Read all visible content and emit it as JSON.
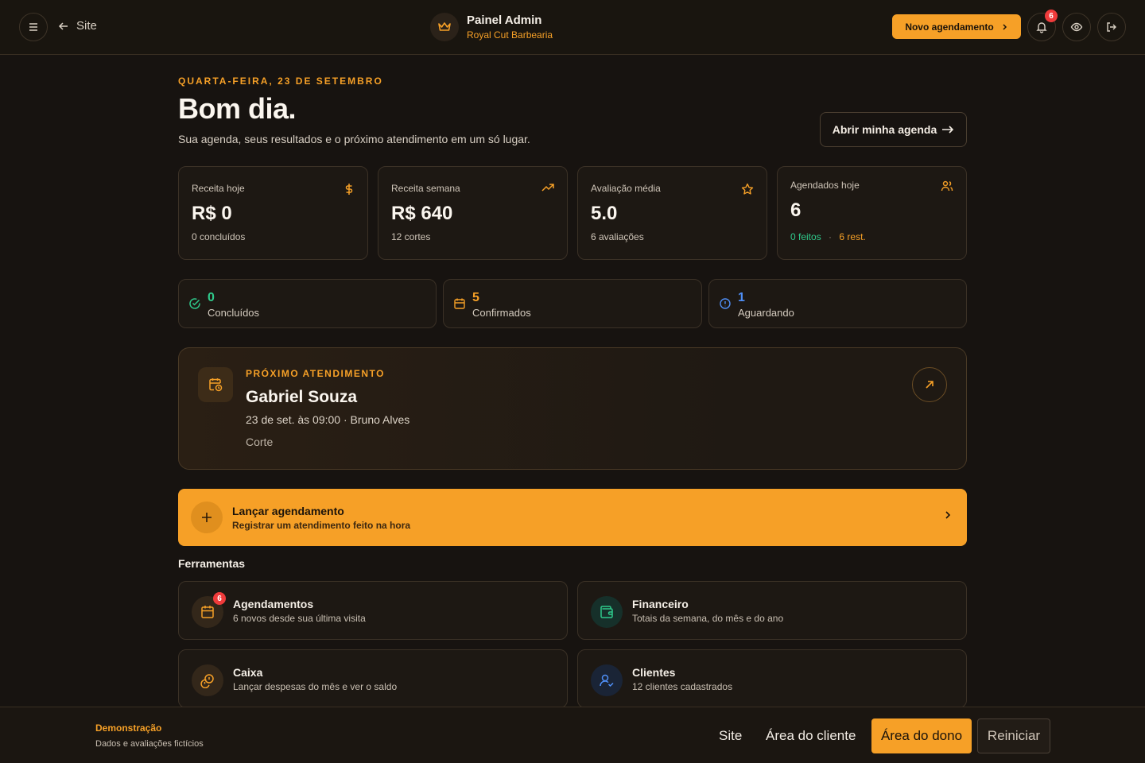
{
  "header": {
    "site_link": "Site",
    "brand_title": "Painel Admin",
    "brand_subtitle": "Royal Cut Barbearia",
    "new_appointment_button": "Novo agendamento",
    "notification_count": "6"
  },
  "hero": {
    "date": "QUARTA-FEIRA, 23 DE SETEMBRO",
    "greeting": "Bom dia.",
    "subtitle": "Sua agenda, seus resultados e o próximo atendimento em um só lugar.",
    "open_agenda_button": "Abrir minha agenda"
  },
  "stats": [
    {
      "label": "Receita hoje",
      "value": "R$ 0",
      "sub": "0 concluídos",
      "icon": "dollar-icon"
    },
    {
      "label": "Receita semana",
      "value": "R$ 640",
      "sub": "12 cortes",
      "icon": "trending-up-icon"
    },
    {
      "label": "Avaliação média",
      "value": "5.0",
      "sub": "6 avaliações",
      "icon": "star-icon"
    },
    {
      "label": "Agendados hoje",
      "value": "6",
      "sub_done": "0 feitos",
      "sub_sep": "·",
      "sub_rest": "6 rest.",
      "icon": "users-icon"
    }
  ],
  "status": [
    {
      "value": "0",
      "label": "Concluídos",
      "color": "#2fc98b"
    },
    {
      "value": "5",
      "label": "Confirmados",
      "color": "#f6a027"
    },
    {
      "value": "1",
      "label": "Aguardando",
      "color": "#4f8ff7"
    }
  ],
  "next": {
    "kicker": "PRÓXIMO ATENDIMENTO",
    "client": "Gabriel Souza",
    "when": "23 de set. às 09:00 · Bruno Alves",
    "service": "Corte"
  },
  "launch": {
    "title": "Lançar agendamento",
    "subtitle": "Registrar um atendimento feito na hora"
  },
  "tools": {
    "title": "Ferramentas",
    "items": [
      {
        "title": "Agendamentos",
        "subtitle": "6 novos desde sua última visita",
        "badge": "6"
      },
      {
        "title": "Financeiro",
        "subtitle": "Totais da semana, do mês e do ano"
      },
      {
        "title": "Caixa",
        "subtitle": "Lançar despesas do mês e ver o saldo"
      },
      {
        "title": "Clientes",
        "subtitle": "12 clientes cadastrados"
      }
    ]
  },
  "footer": {
    "demo_title": "Demonstração",
    "demo_subtitle": "Dados e avaliações fictícios",
    "links": [
      "Site",
      "Área do cliente",
      "Área do dono",
      "Reiniciar"
    ]
  },
  "colors": {
    "accent": "#f6a027",
    "success": "#2fc98b",
    "info": "#4f8ff7",
    "danger": "#ef3b3b"
  }
}
